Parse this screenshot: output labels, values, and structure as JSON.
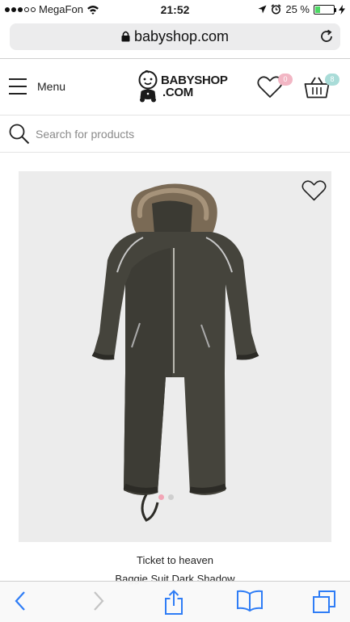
{
  "status_bar": {
    "carrier": "MegaFon",
    "time": "21:52",
    "battery_percent": "25 %",
    "battery_level": 0.25
  },
  "browser": {
    "url": "babyshop.com"
  },
  "header": {
    "menu_label": "Menu",
    "logo_line1": "BABYSHOP",
    "logo_line2": ".COM",
    "wishlist_count": "0",
    "cart_count": "8",
    "wishlist_badge_color": "#f2b6c4",
    "cart_badge_color": "#a9dcd8"
  },
  "search": {
    "placeholder": "Search for products"
  },
  "product": {
    "brand": "Ticket to heaven",
    "name": "Baggie Suit Dark Shadow",
    "image_bg": "#ececec",
    "carousel_active_color": "#f2a5b6",
    "carousel_inactive_color": "#cfcfcf",
    "carousel_dots": 2,
    "carousel_index": 1
  },
  "icons": {
    "wishlist": "heart-icon",
    "cart": "basket-icon",
    "search": "magnifier-icon",
    "favorite": "heart-outline-icon",
    "back": "chevron-left-icon",
    "forward": "chevron-right-icon",
    "share": "share-icon",
    "bookmarks": "book-icon",
    "tabs": "tabs-icon"
  }
}
